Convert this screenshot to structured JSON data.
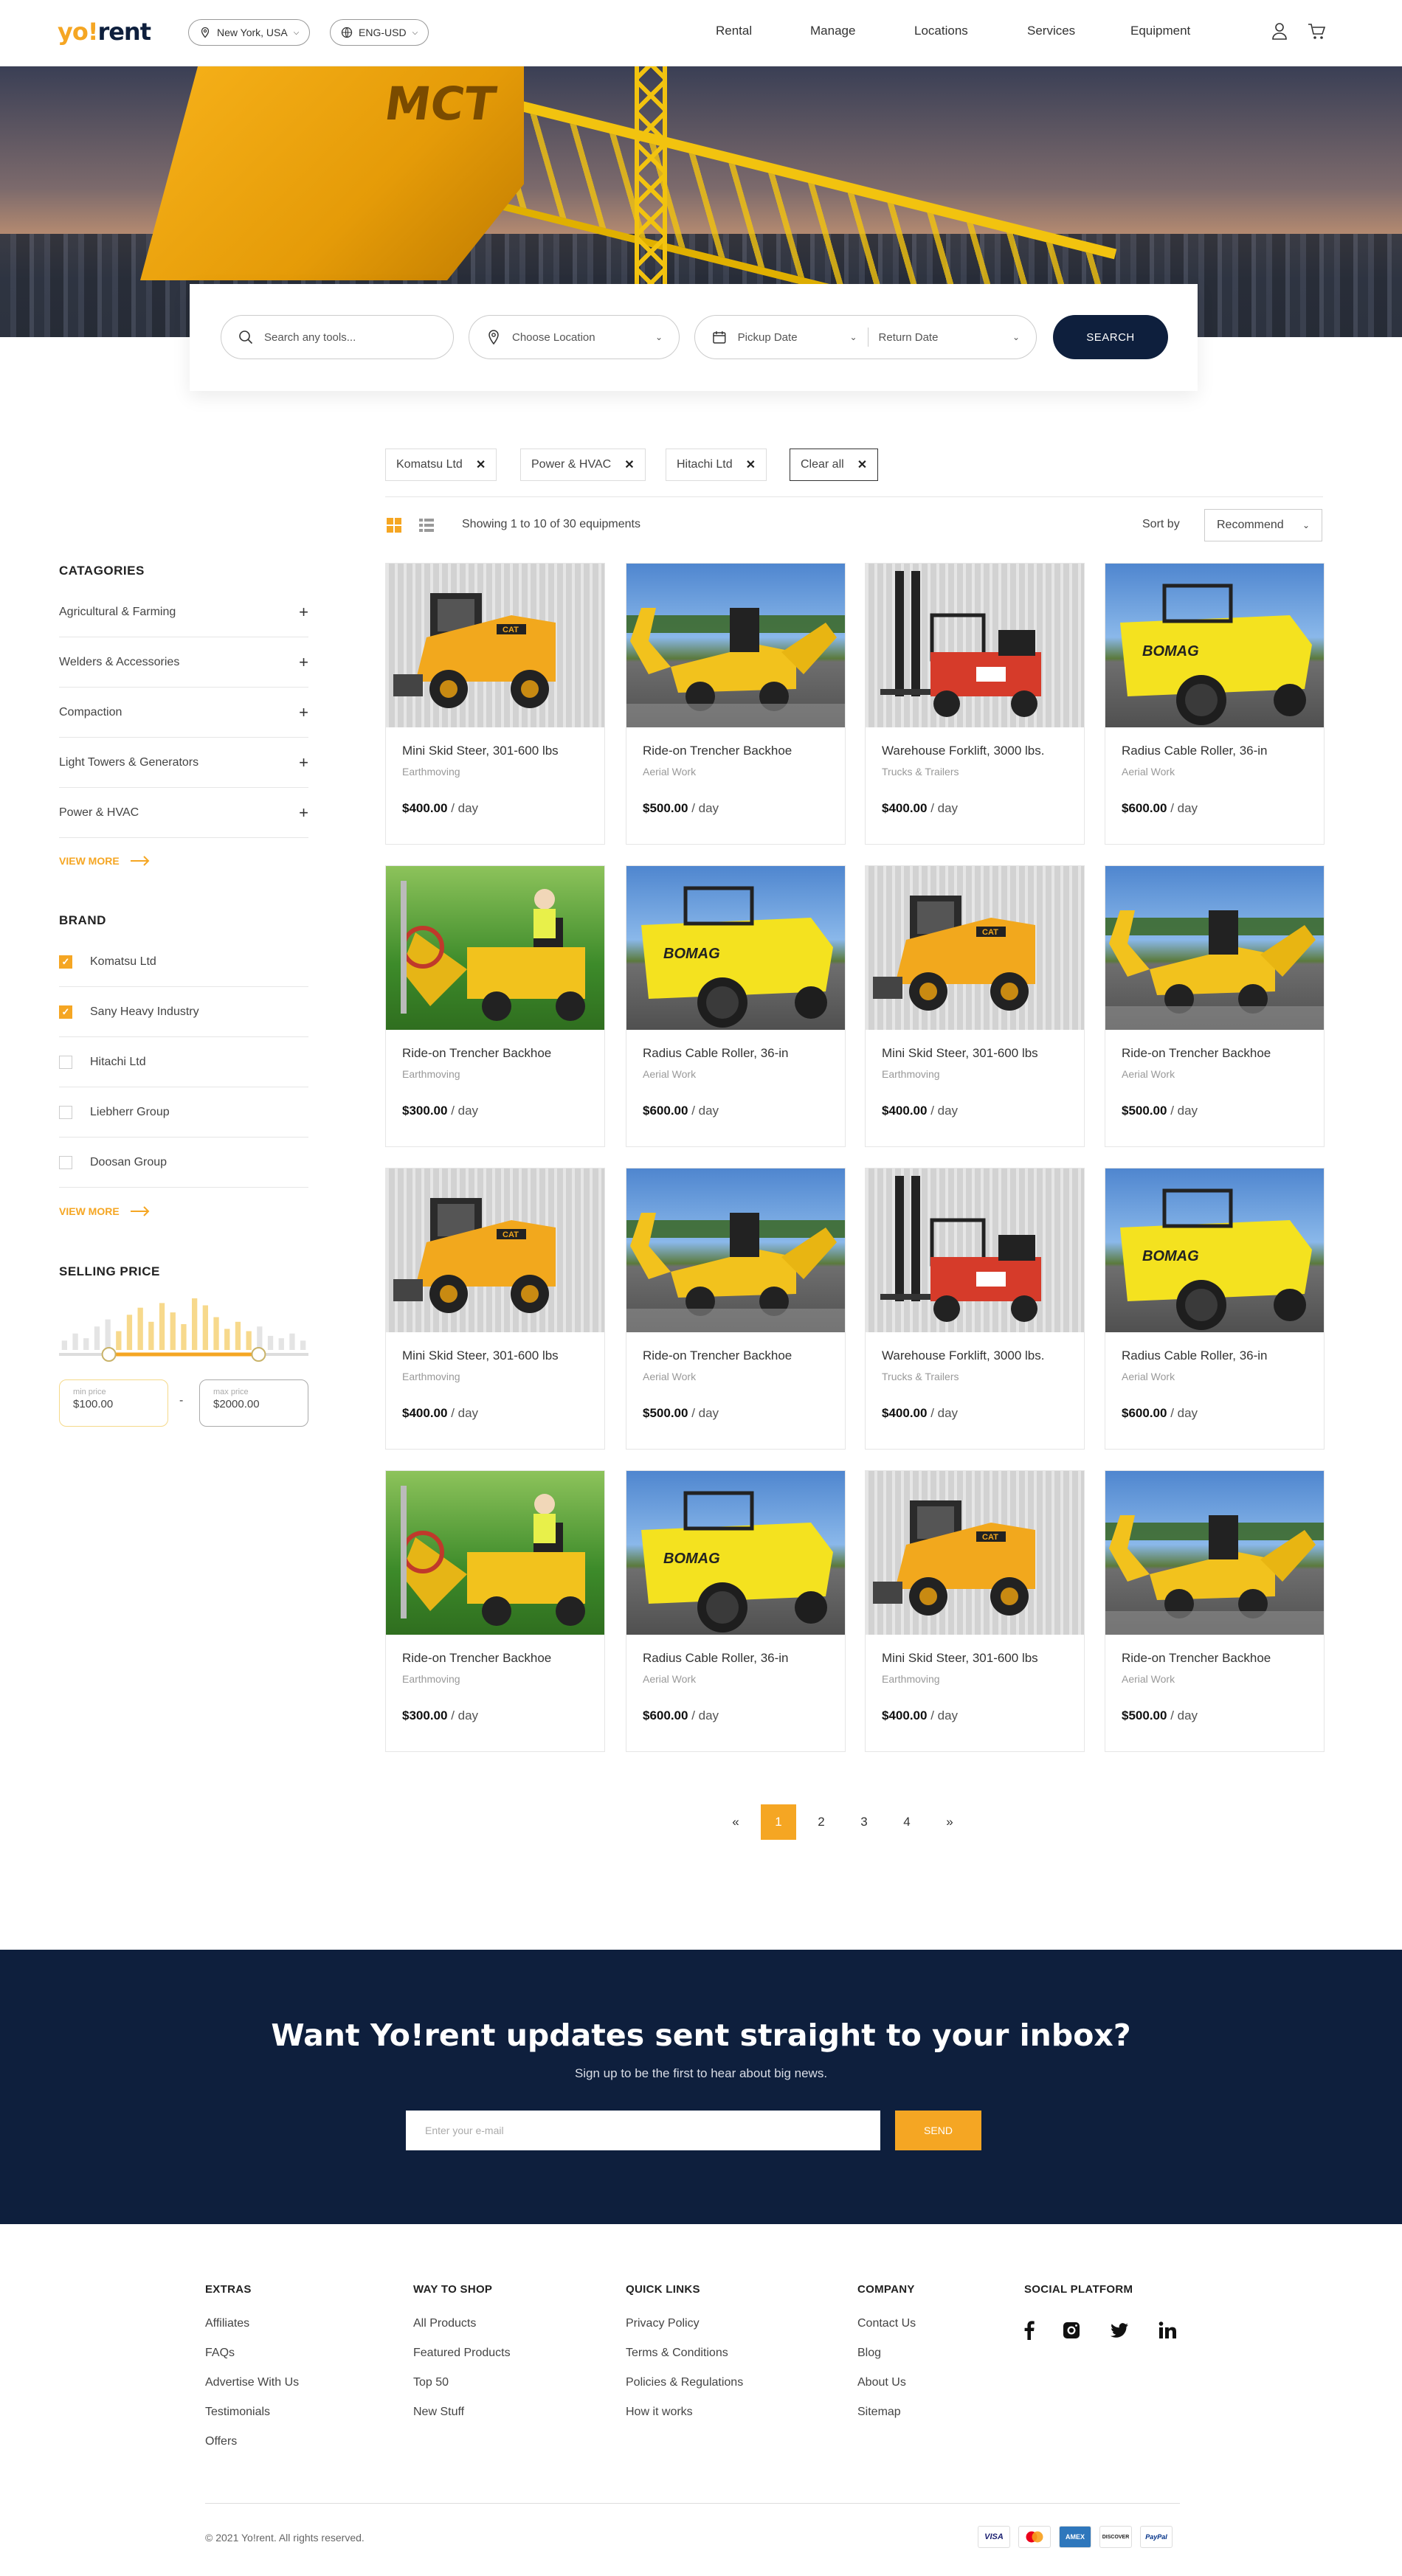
{
  "header": {
    "logo_part1": "yo!",
    "logo_part2": "rent",
    "location": "New York, USA",
    "currency": "ENG-USD",
    "nav": [
      "Rental",
      "Manage",
      "Locations",
      "Services",
      "Equipment"
    ]
  },
  "hero": {
    "crane_text": "MCT"
  },
  "search": {
    "tools_placeholder": "Search any tools...",
    "location_placeholder": "Choose Location",
    "pickup_placeholder": "Pickup Date",
    "return_placeholder": "Return Date",
    "button": "SEARCH"
  },
  "filters": {
    "chips": [
      "Komatsu Ltd",
      "Power & HVAC",
      "Hitachi Ltd"
    ],
    "clear": "Clear all"
  },
  "toolbar": {
    "showing": "Showing 1 to 10 of 30 equipments",
    "sort_label": "Sort by",
    "sort_value": "Recommend"
  },
  "sidebar": {
    "categories_title": "CATAGORIES",
    "categories": [
      "Agricultural & Farming",
      "Welders & Accessories",
      "Compaction",
      "Light Towers & Generators",
      "Power & HVAC"
    ],
    "view_more": "VIEW MORE",
    "brand_title": "BRAND",
    "brands": [
      {
        "label": "Komatsu Ltd",
        "checked": true
      },
      {
        "label": "Sany Heavy Industry",
        "checked": true
      },
      {
        "label": "Hitachi Ltd",
        "checked": false
      },
      {
        "label": "Liebherr Group",
        "checked": false
      },
      {
        "label": "Doosan Group",
        "checked": false
      }
    ],
    "price_title": "SELLING PRICE",
    "min_label": "min price",
    "min_value": "$100.00",
    "max_label": "max price",
    "max_value": "$2000.00",
    "range_sep": "-",
    "histogram": [
      4,
      7,
      5,
      10,
      13,
      8,
      15,
      18,
      12,
      20,
      16,
      11,
      22,
      19,
      14,
      9,
      12,
      8,
      10,
      6,
      5,
      7,
      4
    ],
    "range": [
      0.2,
      0.8
    ]
  },
  "products": [
    {
      "name": "Mini Skid Steer, 301-600 lbs",
      "category": "Earthmoving",
      "price": "$400.00",
      "unit": "/ day",
      "scene": "skid"
    },
    {
      "name": "Ride-on Trencher Backhoe",
      "category": "Aerial Work",
      "price": "$500.00",
      "unit": "/ day",
      "scene": "trencher"
    },
    {
      "name": "Warehouse Forklift, 3000 lbs.",
      "category": "Trucks & Trailers",
      "price": "$400.00",
      "unit": "/ day",
      "scene": "forklift"
    },
    {
      "name": "Radius Cable Roller, 36-in",
      "category": "Aerial Work",
      "price": "$600.00",
      "unit": "/ day",
      "scene": "roller"
    },
    {
      "name": "Ride-on Trencher Backhoe",
      "category": "Earthmoving",
      "price": "$300.00",
      "unit": "/ day",
      "scene": "worker"
    },
    {
      "name": "Radius Cable Roller, 36-in",
      "category": "Aerial Work",
      "price": "$600.00",
      "unit": "/ day",
      "scene": "roller"
    },
    {
      "name": "Mini Skid Steer, 301-600 lbs",
      "category": "Earthmoving",
      "price": "$400.00",
      "unit": "/ day",
      "scene": "skid"
    },
    {
      "name": "Ride-on Trencher Backhoe",
      "category": "Aerial Work",
      "price": "$500.00",
      "unit": "/ day",
      "scene": "trencher"
    },
    {
      "name": "Mini Skid Steer, 301-600 lbs",
      "category": "Earthmoving",
      "price": "$400.00",
      "unit": "/ day",
      "scene": "skid"
    },
    {
      "name": "Ride-on Trencher Backhoe",
      "category": "Aerial Work",
      "price": "$500.00",
      "unit": "/ day",
      "scene": "trencher"
    },
    {
      "name": "Warehouse Forklift, 3000 lbs.",
      "category": "Trucks & Trailers",
      "price": "$400.00",
      "unit": "/ day",
      "scene": "forklift"
    },
    {
      "name": "Radius Cable Roller, 36-in",
      "category": "Aerial Work",
      "price": "$600.00",
      "unit": "/ day",
      "scene": "roller"
    },
    {
      "name": "Ride-on Trencher Backhoe",
      "category": "Earthmoving",
      "price": "$300.00",
      "unit": "/ day",
      "scene": "worker"
    },
    {
      "name": "Radius Cable Roller, 36-in",
      "category": "Aerial Work",
      "price": "$600.00",
      "unit": "/ day",
      "scene": "roller"
    },
    {
      "name": "Mini Skid Steer, 301-600 lbs",
      "category": "Earthmoving",
      "price": "$400.00",
      "unit": "/ day",
      "scene": "skid"
    },
    {
      "name": "Ride-on Trencher Backhoe",
      "category": "Aerial Work",
      "price": "$500.00",
      "unit": "/ day",
      "scene": "trencher"
    }
  ],
  "pagination": {
    "prev": "«",
    "pages": [
      "1",
      "2",
      "3",
      "4"
    ],
    "active": "1",
    "next": "»"
  },
  "newsletter": {
    "title": "Want Yo!rent updates sent straight to your inbox?",
    "subtitle": "Sign up to be the first to hear about big news.",
    "placeholder": "Enter your e-mail",
    "button": "SEND"
  },
  "footer": {
    "columns": [
      {
        "title": "EXTRAS",
        "links": [
          "Affiliates",
          "FAQs",
          "Advertise With Us",
          "Testimonials",
          "Offers"
        ]
      },
      {
        "title": "WAY TO SHOP",
        "links": [
          "All Products",
          "Featured Products",
          "Top 50",
          "New Stuff"
        ]
      },
      {
        "title": "QUICK LINKS",
        "links": [
          "Privacy Policy",
          "Terms & Conditions",
          "Policies & Regulations",
          "How it works"
        ]
      },
      {
        "title": "COMPANY",
        "links": [
          "Contact Us",
          "Blog",
          "About Us",
          "Sitemap"
        ]
      }
    ],
    "social_title": "SOCIAL PLATFORM",
    "social": [
      "facebook-icon",
      "instagram-icon",
      "twitter-icon",
      "linkedin-icon"
    ],
    "copyright": "© 2021 Yo!rent. All rights reserved.",
    "payments": [
      "VISA",
      "MC",
      "AMEX",
      "DISCOVER",
      "PayPal"
    ]
  },
  "colors": {
    "accent": "#f5a623",
    "navy": "#0e1f3d"
  }
}
